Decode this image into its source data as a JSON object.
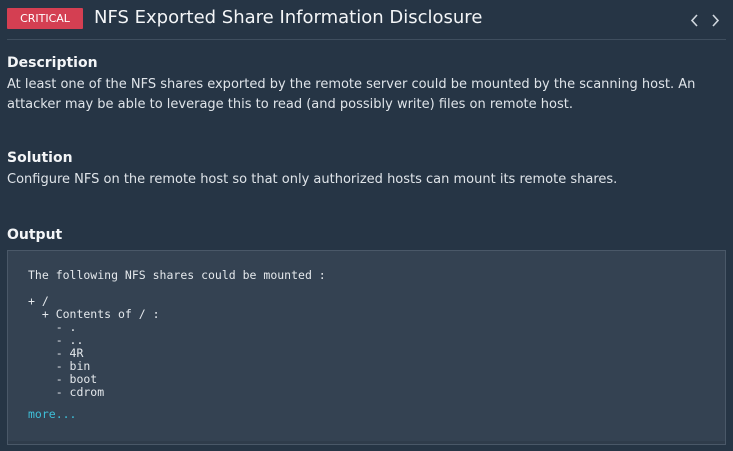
{
  "header": {
    "severity": "CRITICAL",
    "title": "NFS Exported Share Information Disclosure",
    "prev_icon": "chevron-left-icon",
    "next_icon": "chevron-right-icon"
  },
  "description": {
    "heading": "Description",
    "text": "At least one of the NFS shares exported by the remote server could be mounted by the scanning host. An attacker may be able to leverage this to read (and possibly write) files on remote host."
  },
  "solution": {
    "heading": "Solution",
    "text": "Configure NFS on the remote host so that only authorized hosts can mount its remote shares."
  },
  "output": {
    "heading": "Output",
    "intro": "The following NFS shares could be mounted :",
    "lines": [
      "+ /",
      "  + Contents of / :",
      "    - .",
      "    - ..",
      "    - 4R",
      "    - bin",
      "    - boot",
      "    - cdrom"
    ],
    "more_label": "more..."
  },
  "colors": {
    "background": "#263545",
    "critical": "#d43f52",
    "link": "#3fbfd8"
  }
}
